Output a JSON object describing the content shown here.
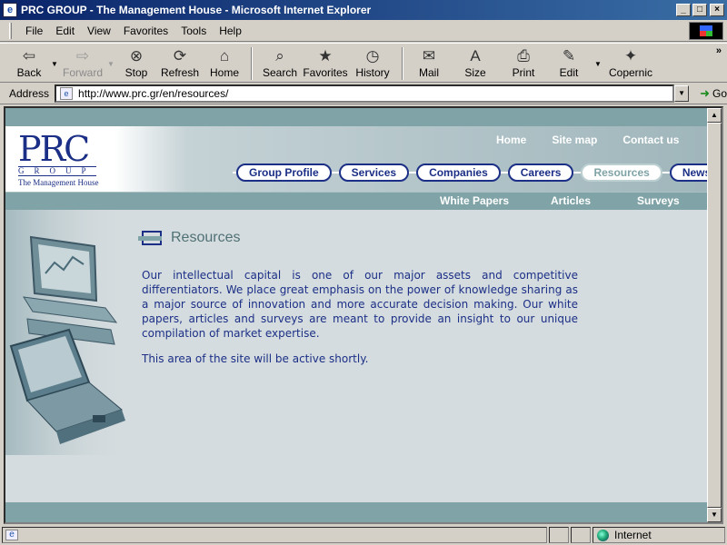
{
  "window": {
    "title": "PRC GROUP - The Management House - Microsoft Internet Explorer",
    "minimize": "_",
    "maximize": "□",
    "close": "×"
  },
  "menu": {
    "items": [
      {
        "label": "File",
        "accel": "F"
      },
      {
        "label": "Edit",
        "accel": "E"
      },
      {
        "label": "View",
        "accel": "V"
      },
      {
        "label": "Favorites",
        "accel": "a"
      },
      {
        "label": "Tools",
        "accel": "T"
      },
      {
        "label": "Help",
        "accel": "H"
      }
    ]
  },
  "toolbar": {
    "back": "Back",
    "forward": "Forward",
    "stop": "Stop",
    "refresh": "Refresh",
    "home": "Home",
    "search": "Search",
    "favorites": "Favorites",
    "history": "History",
    "mail": "Mail",
    "size": "Size",
    "print": "Print",
    "edit": "Edit",
    "copernic": "Copernic",
    "more": "»"
  },
  "address": {
    "label": "Address",
    "url": "http://www.prc.gr/en/resources/",
    "go": "Go"
  },
  "site": {
    "logo": {
      "main": "PRC",
      "group": "GROUP",
      "tagline": "The Management House"
    },
    "top_links": [
      "Home",
      "Site map",
      "Contact us"
    ],
    "nav_tabs": [
      {
        "label": "Group Profile",
        "active": false
      },
      {
        "label": "Services",
        "active": false
      },
      {
        "label": "Companies",
        "active": false
      },
      {
        "label": "Careers",
        "active": false
      },
      {
        "label": "Resources",
        "active": true
      },
      {
        "label": "News",
        "active": false
      }
    ],
    "sub_nav": [
      "White Papers",
      "Articles",
      "Surveys"
    ],
    "page_title": "Resources",
    "paragraphs": [
      "Our intellectual capital is one of our major assets and competitive differentiators. We place great emphasis on the power of knowledge sharing as a major source of innovation and more accurate decision making. Our white papers, articles and surveys are meant to provide an insight to our unique compilation of market expertise.",
      "This area of the site will be active shortly."
    ],
    "colors": {
      "brand_navy": "#1b2f86",
      "brand_teal": "#7fa3a6",
      "background": "#d5dcdf"
    }
  },
  "status": {
    "zone": "Internet"
  }
}
